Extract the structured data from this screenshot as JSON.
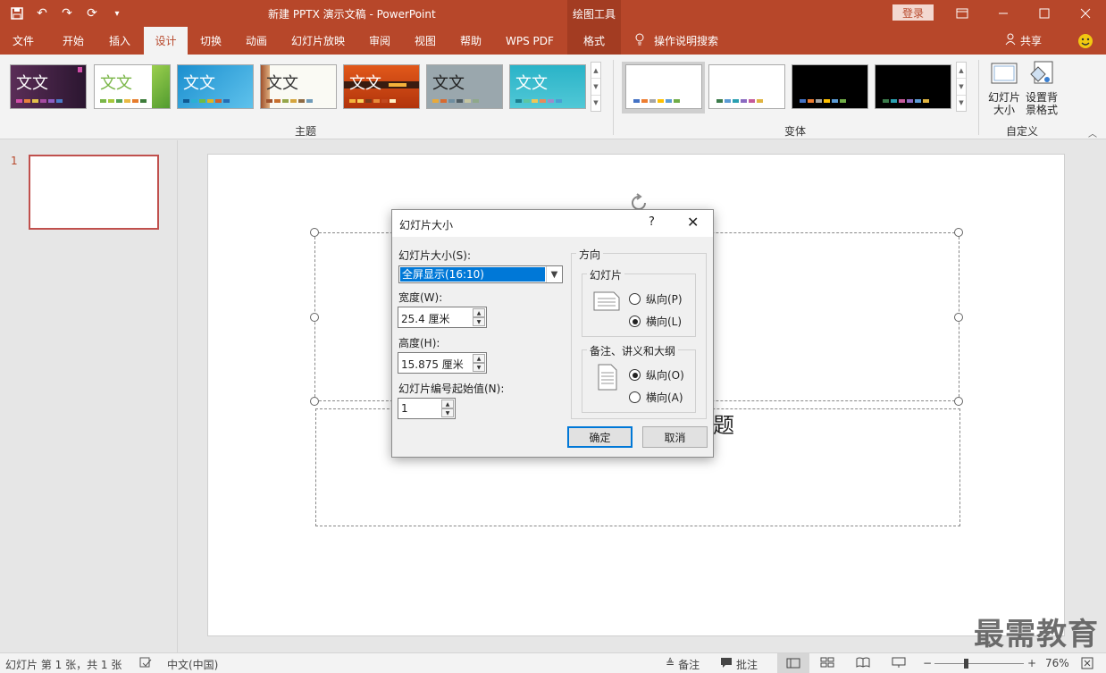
{
  "app": {
    "title": "新建 PPTX 演示文稿  -  PowerPoint",
    "drawing_tools": "绘图工具",
    "login": "登录"
  },
  "tabs": [
    "文件",
    "开始",
    "插入",
    "设计",
    "切换",
    "动画",
    "幻灯片放映",
    "审阅",
    "视图",
    "帮助",
    "WPS PDF",
    "格式"
  ],
  "active_tab": "设计",
  "tell_me": "操作说明搜索",
  "share": "共享",
  "ribbon": {
    "themes_label": "主题",
    "variants_label": "变体",
    "customize_label": "自定义",
    "theme_text": "文文",
    "slide_size_label": "幻灯片大小",
    "bg_format_label": "设置背景格式"
  },
  "thumbnails": [
    {
      "number": "1"
    }
  ],
  "slide": {
    "subtitle_fragment": "题"
  },
  "dialog": {
    "title": "幻灯片大小",
    "help": "?",
    "size_label": "幻灯片大小(S):",
    "size_value": "全屏显示(16:10)",
    "width_label": "宽度(W):",
    "width_value": "25.4 厘米",
    "height_label": "高度(H):",
    "height_value": "15.875 厘米",
    "start_label": "幻灯片编号起始值(N):",
    "start_value": "1",
    "orientation_label": "方向",
    "slides_group": "幻灯片",
    "portrait_p": "纵向(P)",
    "landscape_l": "横向(L)",
    "notes_group": "备注、讲义和大纲",
    "portrait_o": "纵向(O)",
    "landscape_a": "横向(A)",
    "ok": "确定",
    "cancel": "取消"
  },
  "status": {
    "slide_info": "幻灯片 第 1 张，共 1 张",
    "language": "中文(中国)",
    "notes": "备注",
    "comments": "批注",
    "zoom": "76%"
  },
  "watermark": "最需教育",
  "colors": {
    "accent": "#b7472a",
    "selection": "#0078d7"
  }
}
